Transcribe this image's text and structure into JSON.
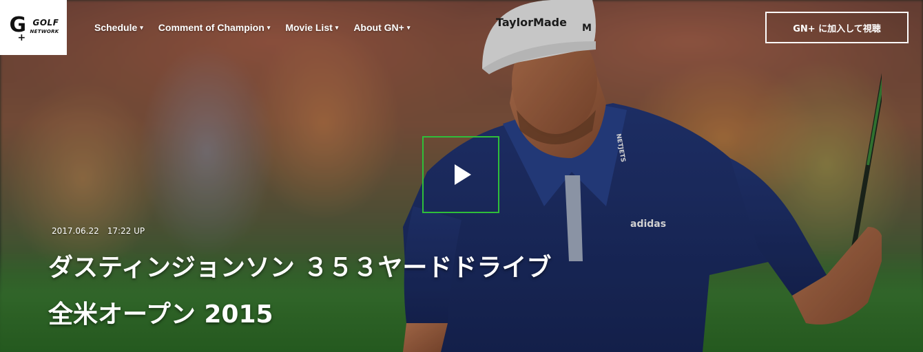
{
  "logo": {
    "mark": "G",
    "plus": "+",
    "word1": "GOLF",
    "word2": "NETWORK"
  },
  "nav": {
    "items": [
      {
        "label": "Schedule"
      },
      {
        "label": "Comment of Champion"
      },
      {
        "label": "Movie List"
      },
      {
        "label": "About GN+"
      }
    ],
    "caret": "▾"
  },
  "join_button": {
    "label": "GN+ に加入して視聴"
  },
  "video": {
    "date": "2017.06.22　17:22 UP",
    "title_line1": "ダスティンジョンソン ３５３ヤードドライブ",
    "title_line2": "全米オープン 2015"
  },
  "colors": {
    "play_border": "#2fbf3a",
    "shirt": "#1c2f6b",
    "cap": "#f2f2f2"
  },
  "hero": {
    "cap_brand": "TaylorMade",
    "cap_logo": "M",
    "shirt_brand": "adidas",
    "collar_text": "NETJETS"
  }
}
